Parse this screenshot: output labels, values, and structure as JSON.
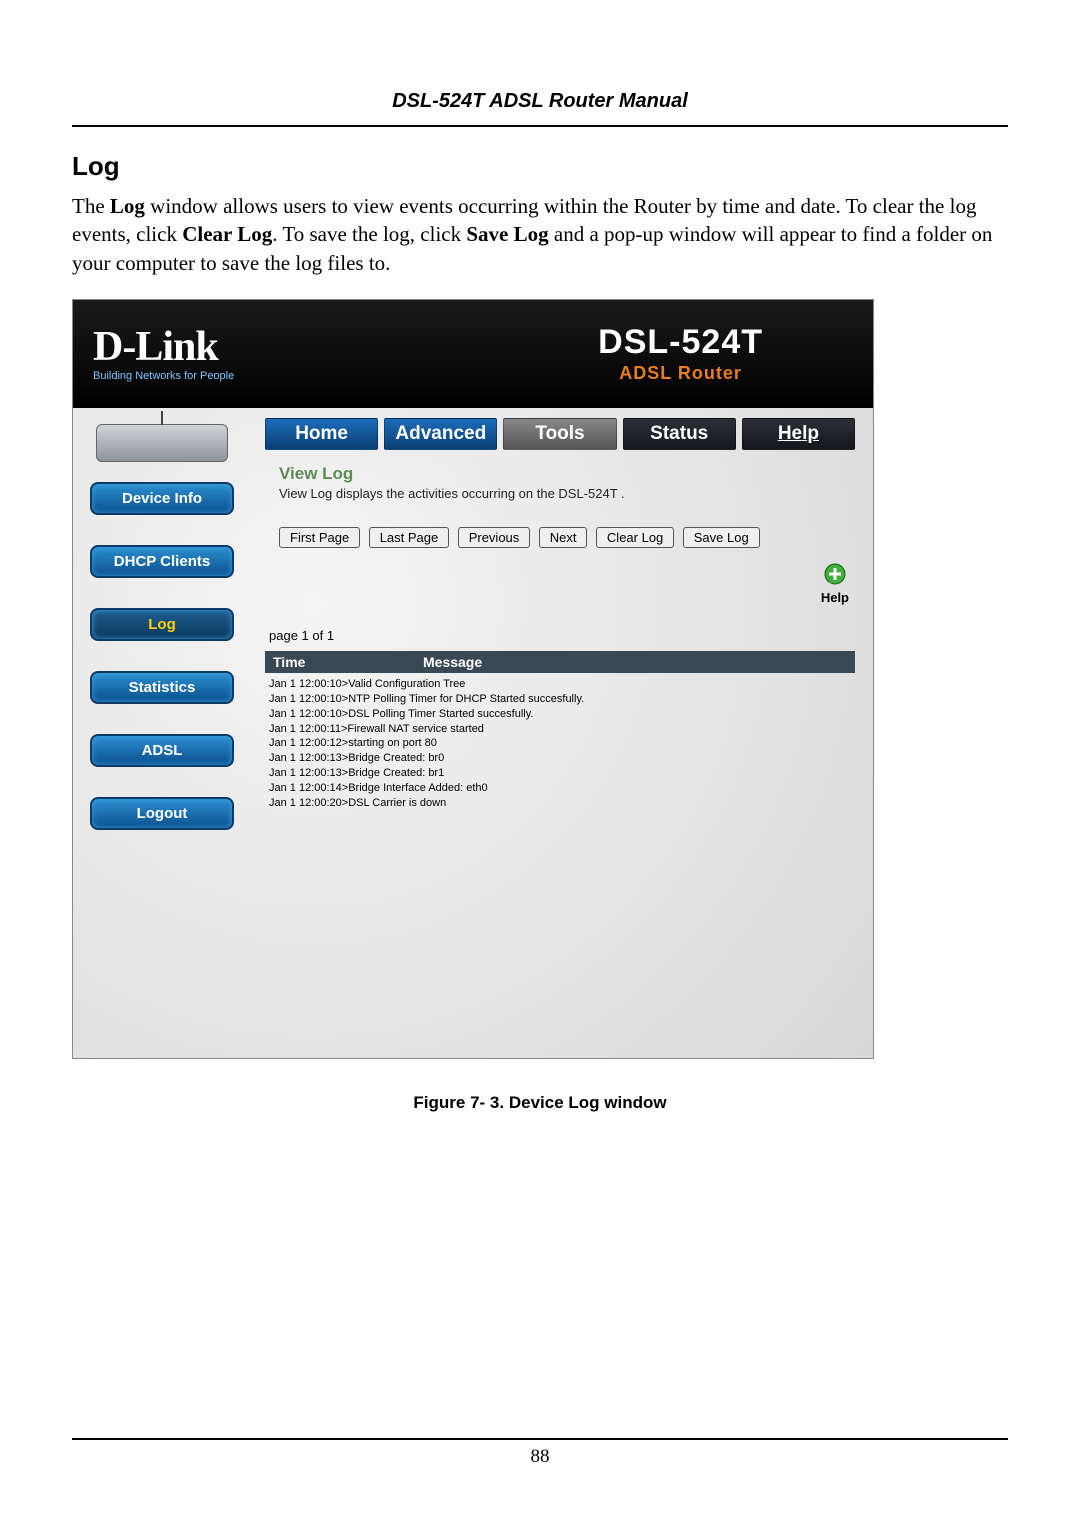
{
  "doc": {
    "title": "DSL-524T ADSL Router Manual",
    "section_heading": "Log",
    "intro_pre": "The ",
    "intro_bold1": "Log",
    "intro_mid1": " window allows users to view events occurring within the Router by time and date. To clear the log events, click ",
    "intro_bold2": "Clear Log",
    "intro_mid2": ". To save the log, click ",
    "intro_bold3": "Save Log",
    "intro_post": " and a pop-up window will appear to find a folder on your computer to save the log files to.",
    "figure_caption": "Figure 7- 3. Device Log window",
    "page_number": "88"
  },
  "screenshot": {
    "logo_brand": "D-Link",
    "logo_tagline": "Building Networks for People",
    "product_model": "DSL-524T",
    "product_type": "ADSL Router",
    "tabs": {
      "home": "Home",
      "advanced": "Advanced",
      "tools": "Tools",
      "status": "Status",
      "help": "Help"
    },
    "sidebar": {
      "device_info": "Device Info",
      "dhcp_clients": "DHCP Clients",
      "log": "Log",
      "statistics": "Statistics",
      "adsl": "ADSL",
      "logout": "Logout"
    },
    "content": {
      "title": "View Log",
      "description": "View Log displays the activities occurring on the DSL-524T .",
      "buttons": {
        "first": "First Page",
        "last": "Last Page",
        "prev": "Previous",
        "next": "Next",
        "clear": "Clear Log",
        "save": "Save Log"
      },
      "help_label": "Help",
      "page_indicator": "page 1 of 1",
      "headers": {
        "time": "Time",
        "message": "Message"
      },
      "entries": [
        {
          "time": "Jan 1 12:00:10>",
          "msg": "Valid Configuration Tree"
        },
        {
          "time": "Jan 1 12:00:10>",
          "msg": "NTP Polling Timer for DHCP Started succesfully."
        },
        {
          "time": "Jan 1 12:00:10>",
          "msg": "DSL Polling Timer Started succesfully."
        },
        {
          "time": "Jan 1 12:00:11>",
          "msg": "Firewall NAT service started"
        },
        {
          "time": "Jan 1 12:00:12>",
          "msg": "starting on port 80"
        },
        {
          "time": "Jan 1 12:00:13>",
          "msg": "Bridge Created: br0"
        },
        {
          "time": "Jan 1 12:00:13>",
          "msg": "Bridge Created: br1"
        },
        {
          "time": "Jan 1 12:00:14>",
          "msg": "Bridge Interface Added: eth0"
        },
        {
          "time": "Jan 1 12:00:20>",
          "msg": "DSL Carrier is down"
        }
      ]
    }
  }
}
